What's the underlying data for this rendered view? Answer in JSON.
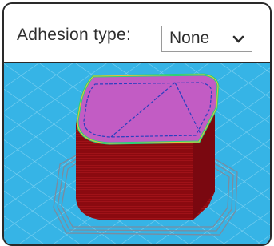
{
  "toolbar": {
    "label": "Adhesion type:",
    "select_value": "None"
  },
  "icons": {
    "dropdown": "chevron-down-icon"
  },
  "colors": {
    "bed": "#36b4e6",
    "bed_grid": "#7fd2f2",
    "model_wall": "#8b0a10",
    "model_top": "#c25cc4",
    "outline": "#2bd07a",
    "inner_path": "#2a3fbf",
    "skirt_lines": "#7a8ca0"
  }
}
